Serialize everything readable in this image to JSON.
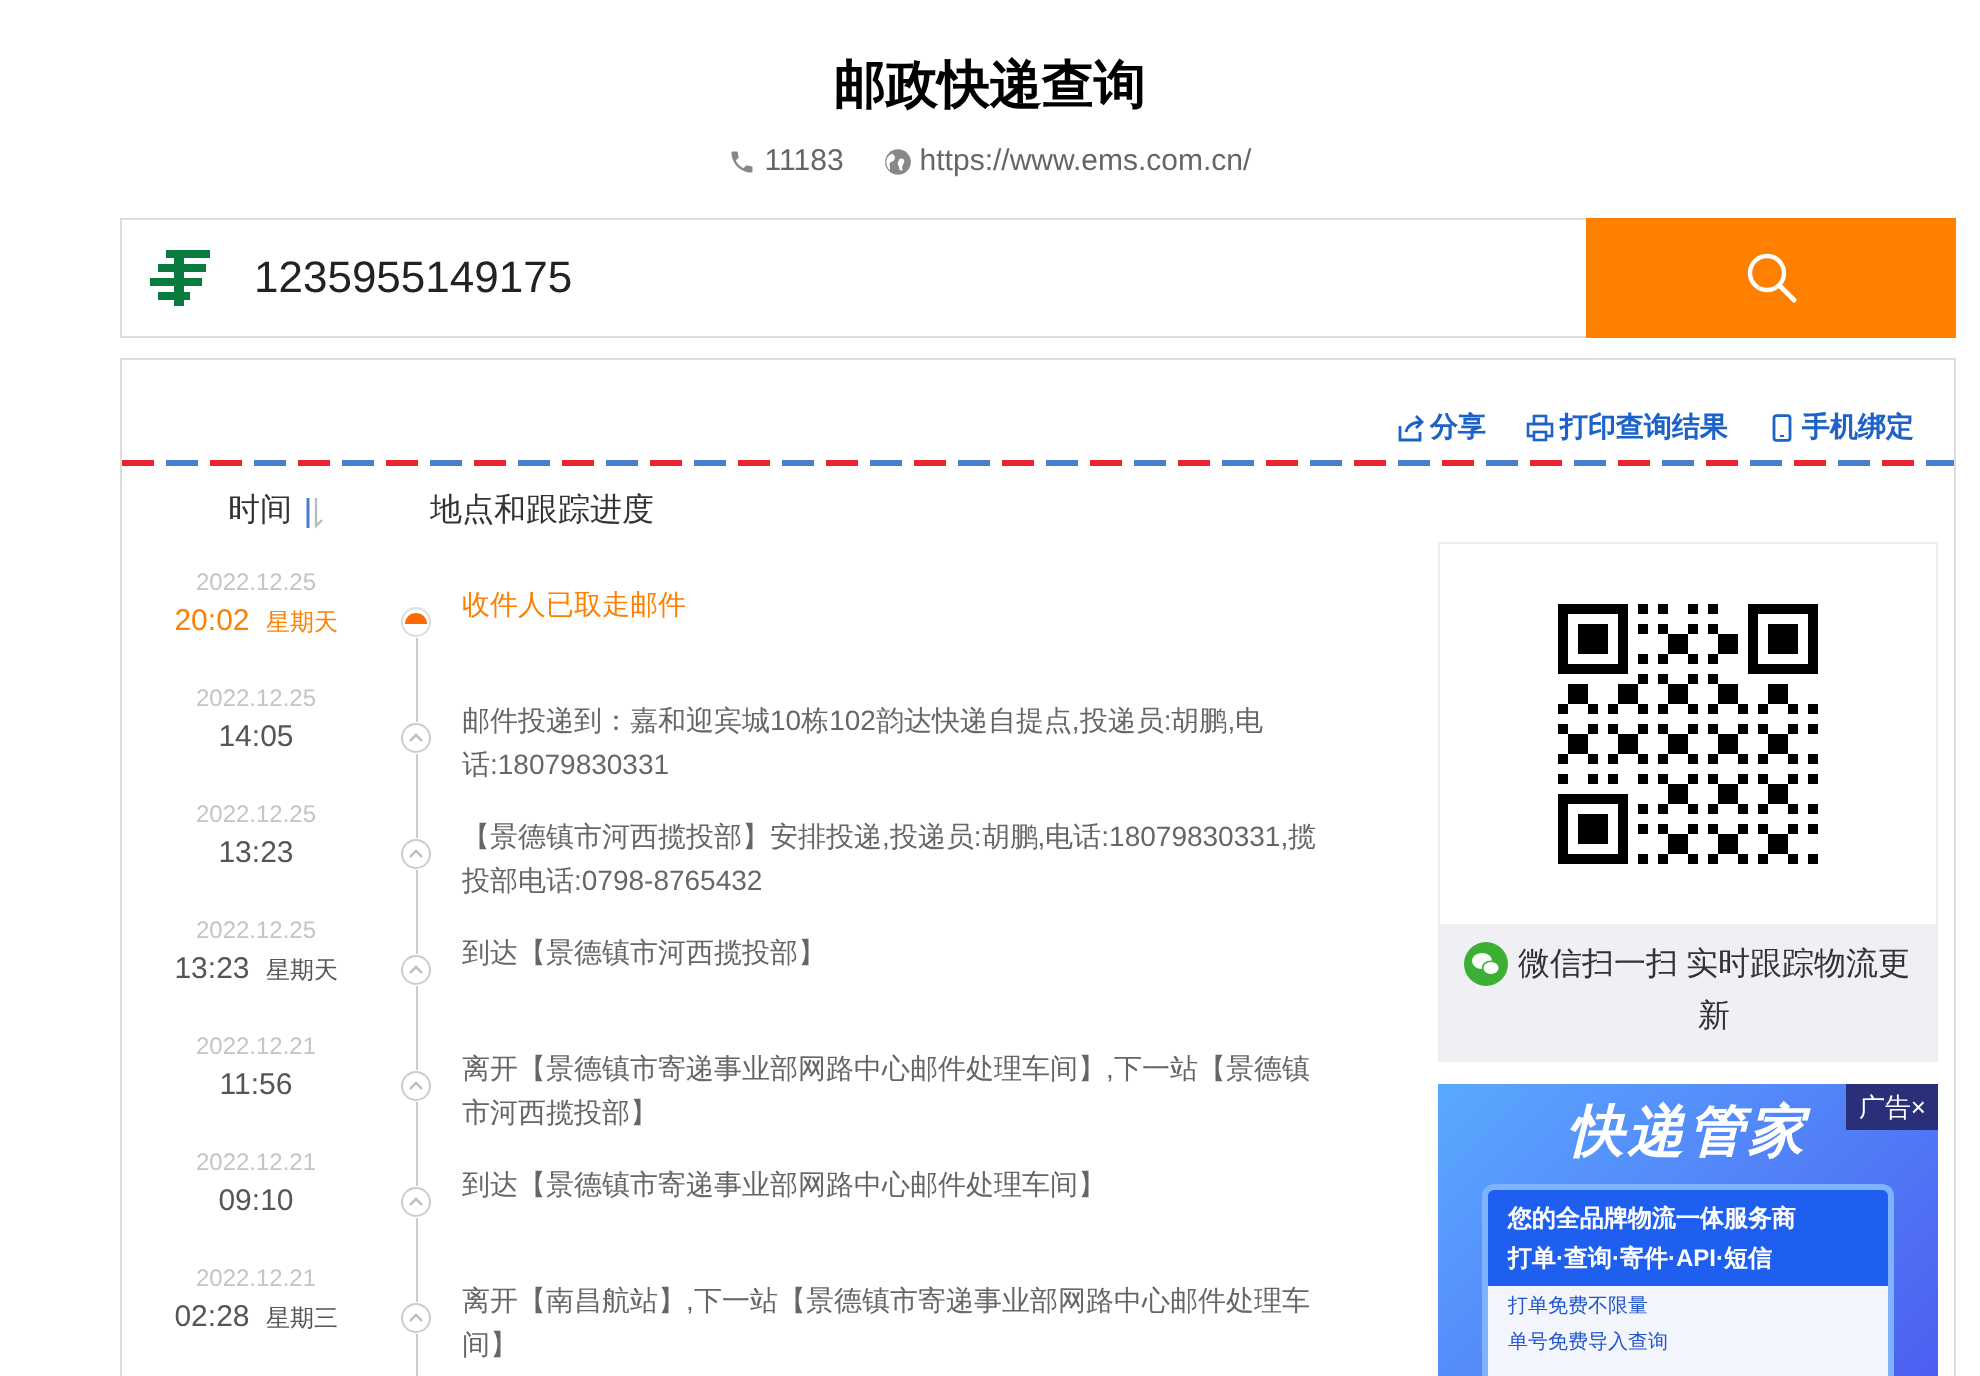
{
  "title": "邮政快递查询",
  "contacts": {
    "phone": "11183",
    "website": "https://www.ems.com.cn/"
  },
  "search": {
    "value": "1235955149175"
  },
  "toolbar": [
    {
      "kind": "share",
      "label": "分享"
    },
    {
      "kind": "print",
      "label": "打印查询结果"
    },
    {
      "kind": "phone",
      "label": "手机绑定"
    }
  ],
  "columns": [
    "时间",
    "地点和跟踪进度"
  ],
  "events": [
    {
      "date": "2022.12.25",
      "time": "20:02",
      "weekday": "星期天",
      "text": "收件人已取走邮件",
      "selected": true
    },
    {
      "date": "2022.12.25",
      "time": "14:05",
      "text": "邮件投递到：嘉和迎宾城10栋102韵达快递自提点,投递员:胡鹏,电话:18079830331",
      "selected": false
    },
    {
      "date": "2022.12.25",
      "time": "13:23",
      "text": "【景德镇市河西揽投部】安排投递,投递员:胡鹏,电话:18079830331,揽投部电话:0798-8765432",
      "selected": false
    },
    {
      "date": "2022.12.25",
      "time": "13:23",
      "weekday": "星期天",
      "text": "到达【景德镇市河西揽投部】",
      "selected": false
    },
    {
      "date": "2022.12.21",
      "time": "11:56",
      "text": "离开【景德镇市寄递事业部网路中心邮件处理车间】,下一站【景德镇市河西揽投部】",
      "selected": false
    },
    {
      "date": "2022.12.21",
      "time": "09:10",
      "text": "到达【景德镇市寄递事业部网路中心邮件处理车间】",
      "selected": false
    },
    {
      "date": "2022.12.21",
      "time": "02:28",
      "weekday": "星期三",
      "text": "离开【南昌航站】,下一站【景德镇市寄递事业部网路中心邮件处理车间】",
      "selected": false
    }
  ],
  "qr_caption": "微信扫一扫 实时跟踪物流更新",
  "ad": {
    "badge": "广告×",
    "headline": "快递管家",
    "lines": [
      "您的全品牌物流一体服务商",
      "打单·查询·寄件·API·短信"
    ],
    "bullets": [
      "打单免费不限量",
      "单号免费导入查询"
    ]
  }
}
